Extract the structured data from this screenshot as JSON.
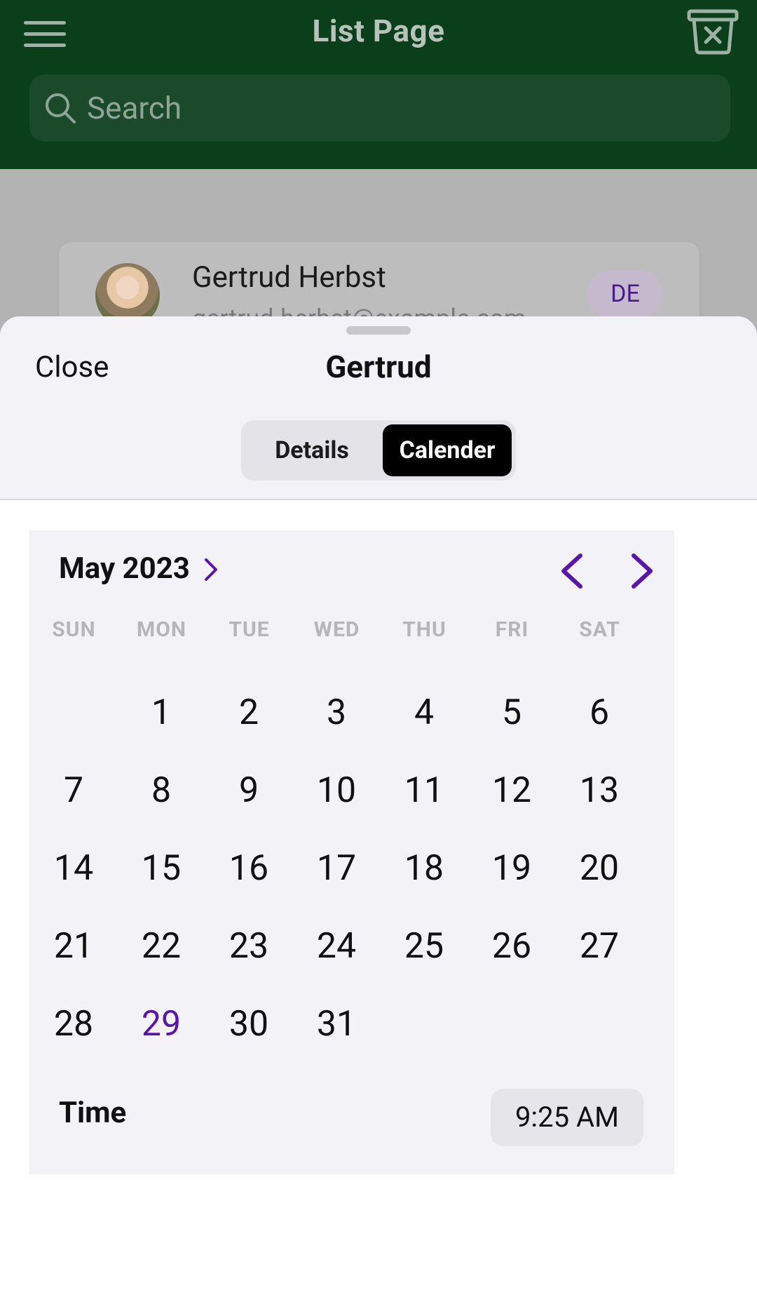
{
  "header": {
    "title": "List Page",
    "search_placeholder": "Search",
    "background_color": "#0b3f1c"
  },
  "list": {
    "items": [
      {
        "name": "Gertrud Herbst",
        "email": "gertrud.herbst@example.com",
        "badge": "DE"
      }
    ]
  },
  "sheet": {
    "close_label": "Close",
    "title": "Gertrud",
    "tabs": [
      {
        "label": "Details",
        "selected": false
      },
      {
        "label": "Calender",
        "selected": true
      }
    ]
  },
  "calendar": {
    "month_label": "May 2023",
    "weekdays": [
      "SUN",
      "MON",
      "TUE",
      "WED",
      "THU",
      "FRI",
      "SAT"
    ],
    "first_weekday_index": 1,
    "days": [
      "1",
      "2",
      "3",
      "4",
      "5",
      "6",
      "7",
      "8",
      "9",
      "10",
      "11",
      "12",
      "13",
      "14",
      "15",
      "16",
      "17",
      "18",
      "19",
      "20",
      "21",
      "22",
      "23",
      "24",
      "25",
      "26",
      "27",
      "28",
      "29",
      "30",
      "31"
    ],
    "highlighted_day": "29",
    "accent_color": "#5a17a6",
    "time_label": "Time",
    "time_value": "9:25 AM"
  }
}
